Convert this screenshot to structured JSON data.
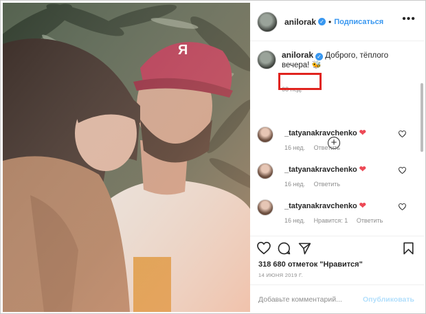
{
  "colors": {
    "accent": "#3897f0",
    "highlight": "#e0231e",
    "heart": "#ed4956"
  },
  "header": {
    "username": "anilorak",
    "follow_label": "Подписаться",
    "dot": "•",
    "more_icon": "more-dots-icon"
  },
  "caption": {
    "username": "anilorak",
    "text": "Доброго, тёплого вечера!",
    "emoji": "🐝",
    "time": "68 нед."
  },
  "comments": [
    {
      "username": "_tatyanakravchenko",
      "time": "16 нед.",
      "likes": "",
      "reply": "Ответить"
    },
    {
      "username": "_tatyanakravchenko",
      "time": "16 нед.",
      "likes": "",
      "reply": "Ответить"
    },
    {
      "username": "_tatyanakravchenko",
      "time": "16 нед.",
      "likes": "Нравится: 1",
      "reply": "Ответить"
    }
  ],
  "actions": {
    "likes": "318 680 отметок \"Нравится\"",
    "date": "14 ИЮНЯ 2019 Г."
  },
  "add_comment": {
    "placeholder": "Добавьте комментарий...",
    "publish": "Опубликовать"
  }
}
